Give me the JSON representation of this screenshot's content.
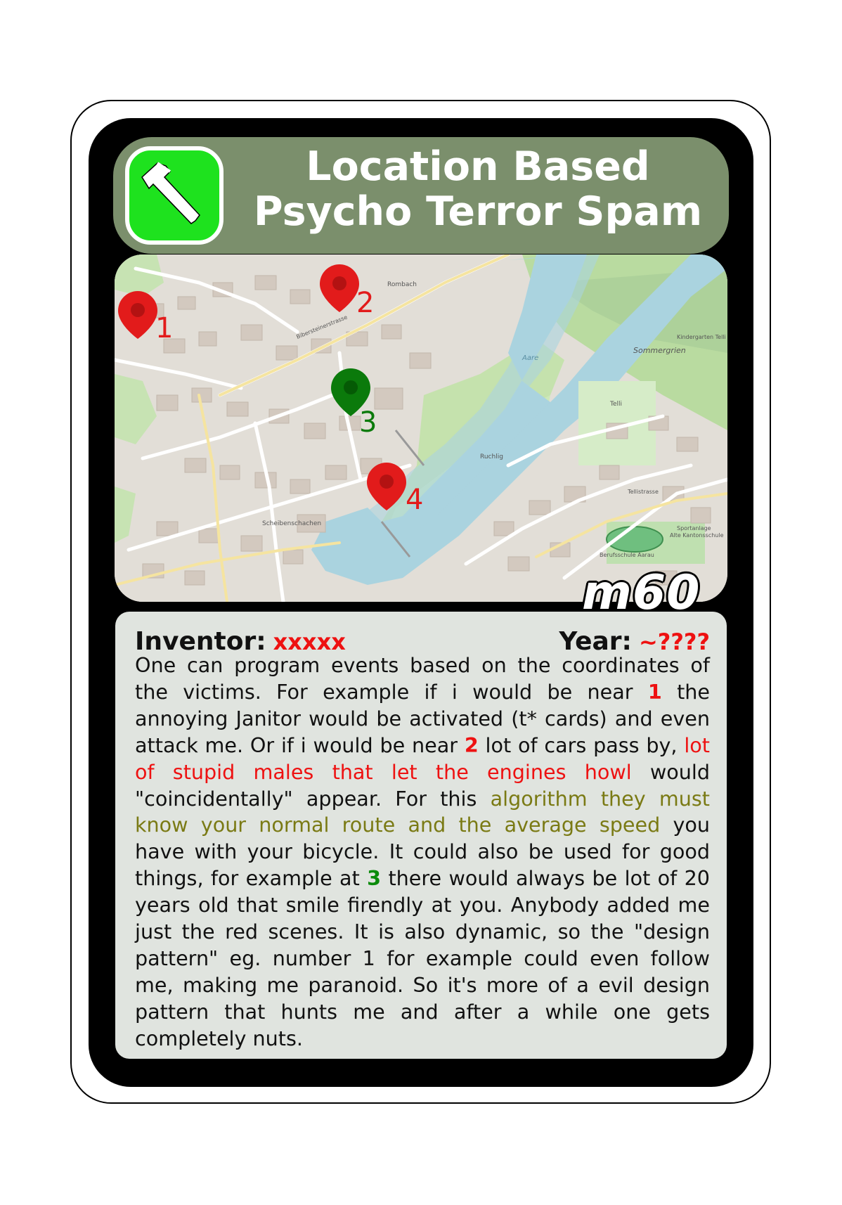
{
  "card": {
    "title_line1": "Location Based",
    "title_line2": "Psycho Terror Spam",
    "icon": "hammer-icon",
    "tag": "m60",
    "colors": {
      "title_bar": "#7b8f6c",
      "icon_bg": "#1ee21e",
      "text_panel": "#e0e4df",
      "red": "#ee1111",
      "green": "#0b8b0b",
      "olive": "#7a7a14"
    }
  },
  "map": {
    "labels": {
      "rombach": "Rombach",
      "sommergrien": "Sommergrien",
      "scheibenschachen": "Scheibenschachen",
      "sportanlage": "Sportanlage",
      "alte_kantonsschule": "Alte Kantonsschule",
      "berufsschule": "Berufsschule Aarau",
      "aare": "Aare",
      "telli": "Telli",
      "kindergarten": "Kindergarten Telli",
      "tellistrasse": "Tellistrasse",
      "biberstein": "Bibersteinerstrasse",
      "ruchlig": "Ruchlig"
    },
    "pins": [
      {
        "number": "1",
        "color": "red"
      },
      {
        "number": "2",
        "color": "red"
      },
      {
        "number": "3",
        "color": "green"
      },
      {
        "number": "4",
        "color": "red"
      }
    ]
  },
  "meta": {
    "inventor_label": "Inventor:",
    "inventor_value": "xxxxx",
    "year_label": "Year:",
    "year_value": "~????"
  },
  "description": {
    "p1": "One can program events based on the coordinates of the victims. For example if i would be near ",
    "n1": "1",
    "p2": " the annoying Janitor would be activated (t* cards) and even attack me. Or if i would be near ",
    "n2": "2",
    "p3": " lot of cars pass by, ",
    "red1": "lot of stupid males that let the engines howl",
    "p4": " would \"coincidentally\" appear. For this ",
    "olive1": "algorithm they must know your normal route and the average speed",
    "p5": " you have with your bicycle. It could also be used for good things, for example at ",
    "n3": "3",
    "p6": " there would always be lot of 20 years old that smile firendly at you. Anybody added me just the red scenes. It is also dynamic, so the \"design pattern\" eg. number 1 for example could even follow me, making me paranoid. So it's more of a evil design pattern that hunts me and after a while one gets completely nuts."
  }
}
